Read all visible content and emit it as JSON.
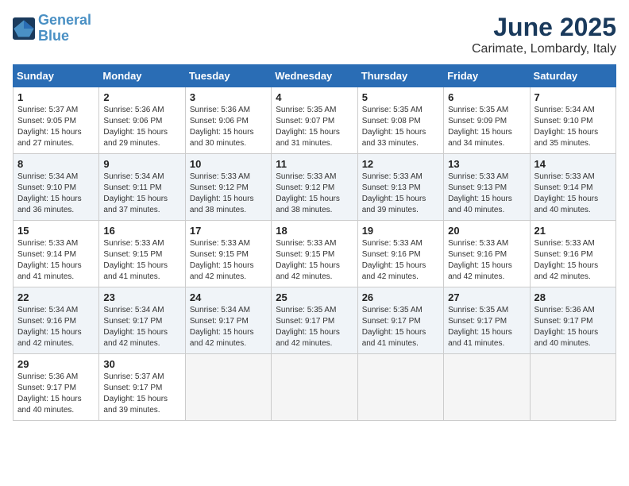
{
  "header": {
    "logo_line1": "General",
    "logo_line2": "Blue",
    "month": "June 2025",
    "location": "Carimate, Lombardy, Italy"
  },
  "days_of_week": [
    "Sunday",
    "Monday",
    "Tuesday",
    "Wednesday",
    "Thursday",
    "Friday",
    "Saturday"
  ],
  "weeks": [
    [
      {
        "day": "1",
        "sunrise": "Sunrise: 5:37 AM",
        "sunset": "Sunset: 9:05 PM",
        "daylight": "Daylight: 15 hours and 27 minutes."
      },
      {
        "day": "2",
        "sunrise": "Sunrise: 5:36 AM",
        "sunset": "Sunset: 9:06 PM",
        "daylight": "Daylight: 15 hours and 29 minutes."
      },
      {
        "day": "3",
        "sunrise": "Sunrise: 5:36 AM",
        "sunset": "Sunset: 9:06 PM",
        "daylight": "Daylight: 15 hours and 30 minutes."
      },
      {
        "day": "4",
        "sunrise": "Sunrise: 5:35 AM",
        "sunset": "Sunset: 9:07 PM",
        "daylight": "Daylight: 15 hours and 31 minutes."
      },
      {
        "day": "5",
        "sunrise": "Sunrise: 5:35 AM",
        "sunset": "Sunset: 9:08 PM",
        "daylight": "Daylight: 15 hours and 33 minutes."
      },
      {
        "day": "6",
        "sunrise": "Sunrise: 5:35 AM",
        "sunset": "Sunset: 9:09 PM",
        "daylight": "Daylight: 15 hours and 34 minutes."
      },
      {
        "day": "7",
        "sunrise": "Sunrise: 5:34 AM",
        "sunset": "Sunset: 9:10 PM",
        "daylight": "Daylight: 15 hours and 35 minutes."
      }
    ],
    [
      {
        "day": "8",
        "sunrise": "Sunrise: 5:34 AM",
        "sunset": "Sunset: 9:10 PM",
        "daylight": "Daylight: 15 hours and 36 minutes."
      },
      {
        "day": "9",
        "sunrise": "Sunrise: 5:34 AM",
        "sunset": "Sunset: 9:11 PM",
        "daylight": "Daylight: 15 hours and 37 minutes."
      },
      {
        "day": "10",
        "sunrise": "Sunrise: 5:33 AM",
        "sunset": "Sunset: 9:12 PM",
        "daylight": "Daylight: 15 hours and 38 minutes."
      },
      {
        "day": "11",
        "sunrise": "Sunrise: 5:33 AM",
        "sunset": "Sunset: 9:12 PM",
        "daylight": "Daylight: 15 hours and 38 minutes."
      },
      {
        "day": "12",
        "sunrise": "Sunrise: 5:33 AM",
        "sunset": "Sunset: 9:13 PM",
        "daylight": "Daylight: 15 hours and 39 minutes."
      },
      {
        "day": "13",
        "sunrise": "Sunrise: 5:33 AM",
        "sunset": "Sunset: 9:13 PM",
        "daylight": "Daylight: 15 hours and 40 minutes."
      },
      {
        "day": "14",
        "sunrise": "Sunrise: 5:33 AM",
        "sunset": "Sunset: 9:14 PM",
        "daylight": "Daylight: 15 hours and 40 minutes."
      }
    ],
    [
      {
        "day": "15",
        "sunrise": "Sunrise: 5:33 AM",
        "sunset": "Sunset: 9:14 PM",
        "daylight": "Daylight: 15 hours and 41 minutes."
      },
      {
        "day": "16",
        "sunrise": "Sunrise: 5:33 AM",
        "sunset": "Sunset: 9:15 PM",
        "daylight": "Daylight: 15 hours and 41 minutes."
      },
      {
        "day": "17",
        "sunrise": "Sunrise: 5:33 AM",
        "sunset": "Sunset: 9:15 PM",
        "daylight": "Daylight: 15 hours and 42 minutes."
      },
      {
        "day": "18",
        "sunrise": "Sunrise: 5:33 AM",
        "sunset": "Sunset: 9:15 PM",
        "daylight": "Daylight: 15 hours and 42 minutes."
      },
      {
        "day": "19",
        "sunrise": "Sunrise: 5:33 AM",
        "sunset": "Sunset: 9:16 PM",
        "daylight": "Daylight: 15 hours and 42 minutes."
      },
      {
        "day": "20",
        "sunrise": "Sunrise: 5:33 AM",
        "sunset": "Sunset: 9:16 PM",
        "daylight": "Daylight: 15 hours and 42 minutes."
      },
      {
        "day": "21",
        "sunrise": "Sunrise: 5:33 AM",
        "sunset": "Sunset: 9:16 PM",
        "daylight": "Daylight: 15 hours and 42 minutes."
      }
    ],
    [
      {
        "day": "22",
        "sunrise": "Sunrise: 5:34 AM",
        "sunset": "Sunset: 9:16 PM",
        "daylight": "Daylight: 15 hours and 42 minutes."
      },
      {
        "day": "23",
        "sunrise": "Sunrise: 5:34 AM",
        "sunset": "Sunset: 9:17 PM",
        "daylight": "Daylight: 15 hours and 42 minutes."
      },
      {
        "day": "24",
        "sunrise": "Sunrise: 5:34 AM",
        "sunset": "Sunset: 9:17 PM",
        "daylight": "Daylight: 15 hours and 42 minutes."
      },
      {
        "day": "25",
        "sunrise": "Sunrise: 5:35 AM",
        "sunset": "Sunset: 9:17 PM",
        "daylight": "Daylight: 15 hours and 42 minutes."
      },
      {
        "day": "26",
        "sunrise": "Sunrise: 5:35 AM",
        "sunset": "Sunset: 9:17 PM",
        "daylight": "Daylight: 15 hours and 41 minutes."
      },
      {
        "day": "27",
        "sunrise": "Sunrise: 5:35 AM",
        "sunset": "Sunset: 9:17 PM",
        "daylight": "Daylight: 15 hours and 41 minutes."
      },
      {
        "day": "28",
        "sunrise": "Sunrise: 5:36 AM",
        "sunset": "Sunset: 9:17 PM",
        "daylight": "Daylight: 15 hours and 40 minutes."
      }
    ],
    [
      {
        "day": "29",
        "sunrise": "Sunrise: 5:36 AM",
        "sunset": "Sunset: 9:17 PM",
        "daylight": "Daylight: 15 hours and 40 minutes."
      },
      {
        "day": "30",
        "sunrise": "Sunrise: 5:37 AM",
        "sunset": "Sunset: 9:17 PM",
        "daylight": "Daylight: 15 hours and 39 minutes."
      },
      null,
      null,
      null,
      null,
      null
    ]
  ]
}
